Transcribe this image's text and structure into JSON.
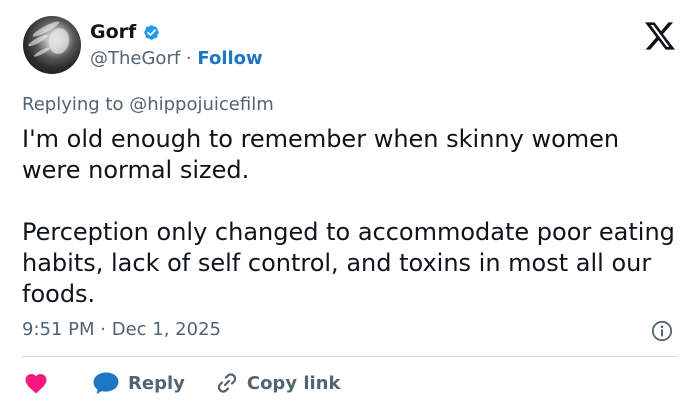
{
  "author": {
    "name": "Gorf",
    "handle": "@TheGorf",
    "separator": "·",
    "follow_label": "Follow",
    "verified": true
  },
  "replying": {
    "prefix": "Replying to",
    "handle": "@hippojuicefilm"
  },
  "tweet": {
    "paragraphs": [
      "I'm old enough to remember when skinny women were normal sized.",
      "Perception only changed to accommodate poor eating habits, lack of self control, and toxins in most all our foods."
    ]
  },
  "timestamp": {
    "time": "9:51 PM",
    "separator": "·",
    "date": "Dec 1, 2025"
  },
  "actions": {
    "reply_label": "Reply",
    "copy_link_label": "Copy link"
  },
  "icons": {
    "logo": "x-logo-icon",
    "verified": "verified-badge-icon",
    "info": "info-icon",
    "like": "heart-icon",
    "reply": "reply-bubble-icon",
    "link": "link-icon"
  },
  "colors": {
    "text": "#0f1419",
    "secondary": "#536471",
    "accent": "#1d76c3",
    "verified": "#1d9bf0",
    "heart": "#f91880",
    "divider": "#cfd9de"
  }
}
